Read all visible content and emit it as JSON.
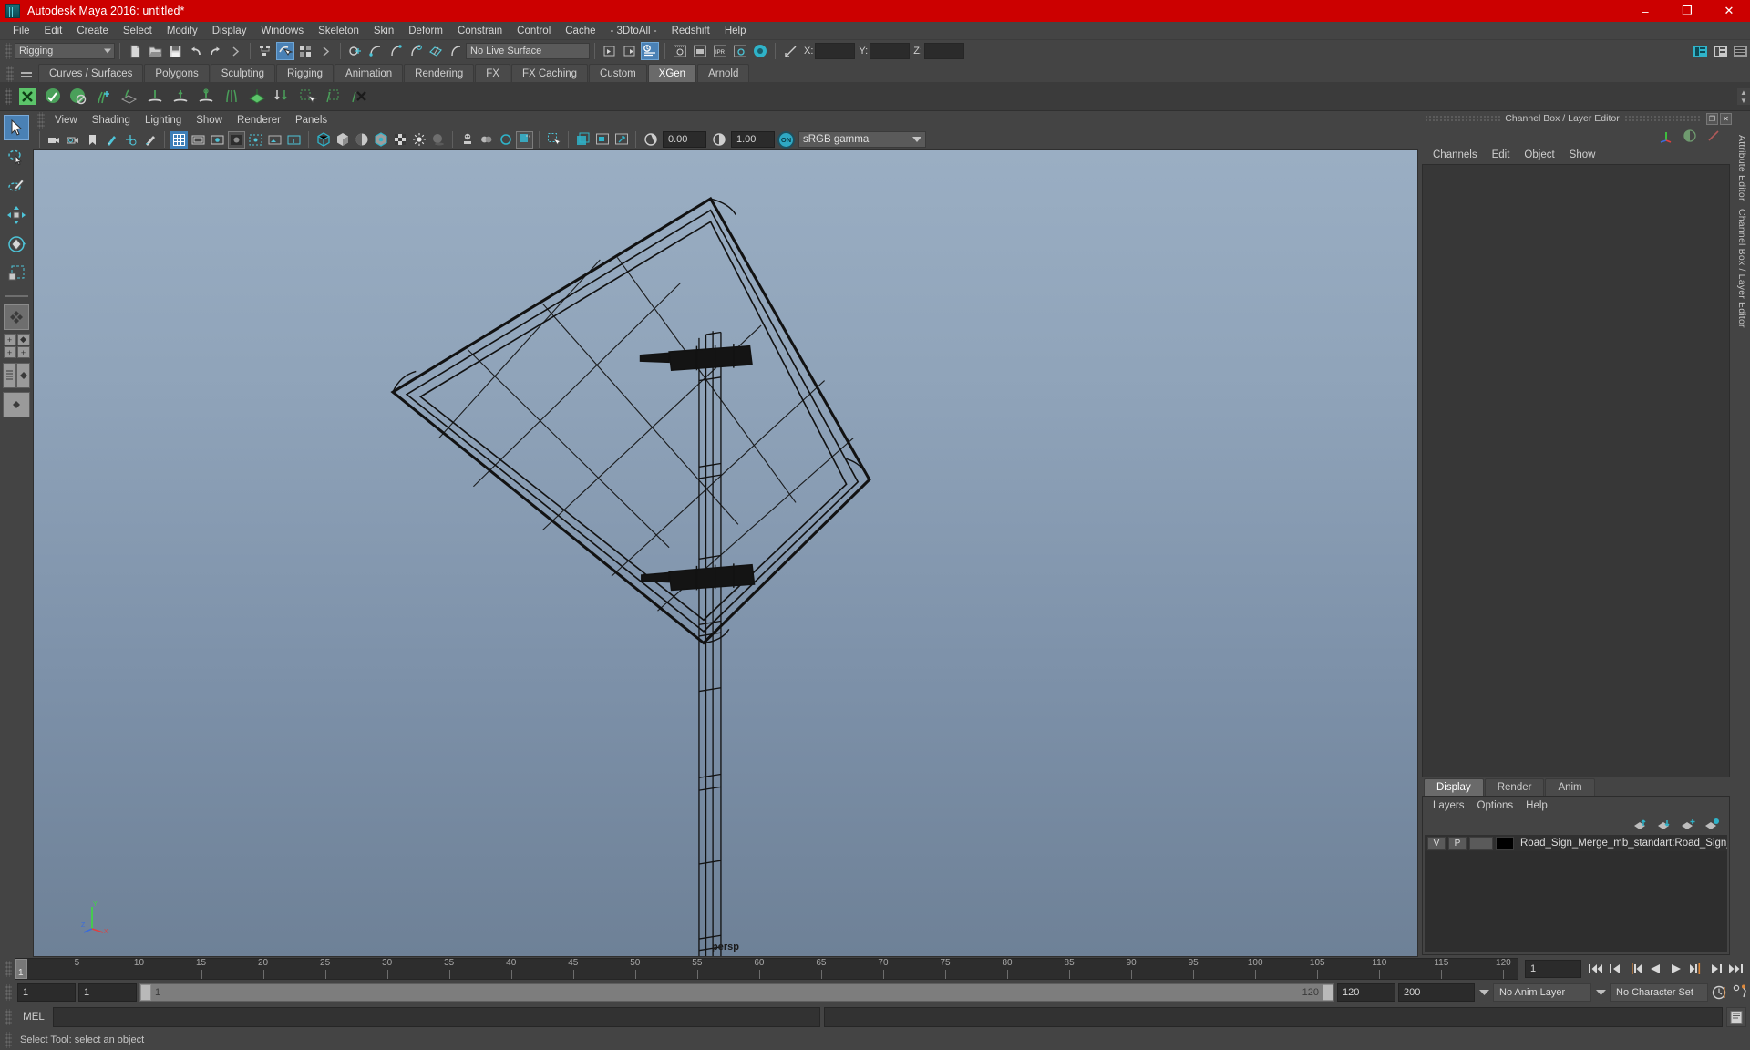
{
  "window": {
    "title": "Autodesk Maya 2016: untitled*",
    "icon": "maya-app-icon",
    "minimize": "–",
    "maximize": "❐",
    "close": "✕"
  },
  "menubar": {
    "items": [
      "File",
      "Edit",
      "Create",
      "Select",
      "Modify",
      "Display",
      "Windows",
      "Skeleton",
      "Skin",
      "Deform",
      "Constrain",
      "Control",
      "Cache",
      "- 3DtoAll -",
      "Redshift",
      "Help"
    ]
  },
  "statusline": {
    "menu_set": "Rigging",
    "live_surface": "No Live Surface",
    "axis": {
      "x_label": "X:",
      "x_value": "",
      "y_label": "Y:",
      "y_value": "",
      "z_label": "Z:",
      "z_value": ""
    }
  },
  "shelf": {
    "tabs": [
      "Curves / Surfaces",
      "Polygons",
      "Sculpting",
      "Rigging",
      "Animation",
      "Rendering",
      "FX",
      "FX Caching",
      "Custom",
      "XGen",
      "Arnold"
    ],
    "active_tab": "XGen"
  },
  "toolbox": {
    "items": [
      "select-tool",
      "lasso-select-tool",
      "paint-select-tool",
      "move-tool",
      "rotate-tool",
      "scale-tool",
      "last-tool-used",
      "four-view-layout",
      "single-perspective-layout",
      "outliner-persp-layout",
      "hypershade-persp-layout"
    ]
  },
  "viewport": {
    "menus": [
      "View",
      "Shading",
      "Lighting",
      "Show",
      "Renderer",
      "Panels"
    ],
    "exposure_value": "0.00",
    "gamma_value": "1.00",
    "color_management_toggle": "ON",
    "color_profile": "sRGB gamma",
    "camera_label": "persp",
    "model_name": "road-sign-wireframe-model",
    "background_top": "#9aaec3",
    "background_bottom": "#6e8197"
  },
  "right_panel": {
    "title": "Channel Box / Layer Editor",
    "menus": [
      "Channels",
      "Edit",
      "Object",
      "Show"
    ],
    "side_tabs": [
      "Attribute Editor",
      "Channel Box / Layer Editor"
    ],
    "layer_editor": {
      "tabs": [
        "Display",
        "Render",
        "Anim"
      ],
      "active_tab": "Display",
      "menus": [
        "Layers",
        "Options",
        "Help"
      ],
      "rows": [
        {
          "visibility": "V",
          "playback": "P",
          "extra": "",
          "color": "#000000",
          "name": "Road_Sign_Merge_mb_standart:Road_Sign_Merge"
        }
      ]
    }
  },
  "timeline": {
    "start": 1,
    "end": 120,
    "current_frame": "1",
    "ticks": [
      5,
      10,
      15,
      20,
      25,
      30,
      35,
      40,
      45,
      50,
      55,
      60,
      65,
      70,
      75,
      80,
      85,
      90,
      95,
      100,
      105,
      110,
      115,
      120
    ],
    "cursor_label": "1",
    "playback_buttons": [
      "go-to-start",
      "step-back-frame",
      "step-back-key",
      "play-backwards",
      "play-forwards",
      "step-forward-key",
      "step-forward-frame",
      "go-to-end"
    ]
  },
  "range_slider": {
    "anim_start": "1",
    "range_start": "1",
    "bar_start_label": "1",
    "bar_end_label": "120",
    "range_end": "120",
    "anim_end": "200",
    "anim_layer": "No Anim Layer",
    "character_set": "No Character Set",
    "auto_key_icon": "auto-keyframe-icon",
    "prefs_icon": "animation-preferences-icon"
  },
  "command_line": {
    "label": "MEL",
    "input_value": "",
    "result_value": "",
    "script_editor_icon": "script-editor-icon"
  },
  "help_line": {
    "text": "Select Tool: select an object"
  }
}
